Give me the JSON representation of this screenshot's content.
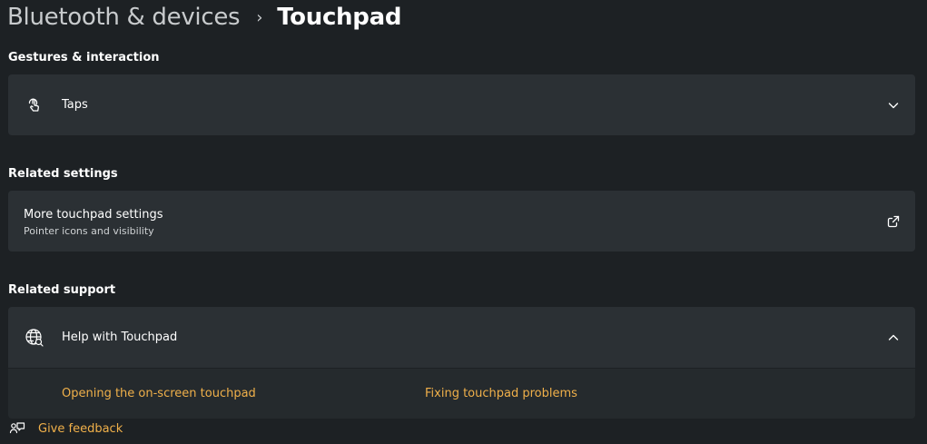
{
  "breadcrumb": {
    "parent": "Bluetooth & devices",
    "separator": "›",
    "current": "Touchpad"
  },
  "sections": {
    "gestures": {
      "title": "Gestures & interaction",
      "taps": {
        "label": "Taps",
        "icon": "touch-tap-icon",
        "chevron": "chevron-down-icon"
      }
    },
    "related_settings": {
      "title": "Related settings",
      "more": {
        "label": "More touchpad settings",
        "sublabel": "Pointer icons and visibility",
        "icon": "open-external-icon"
      }
    },
    "related_support": {
      "title": "Related support",
      "help": {
        "label": "Help with Touchpad",
        "icon": "globe-search-icon",
        "chevron": "chevron-up-icon"
      },
      "links": [
        "Opening the on-screen touchpad",
        "Fixing touchpad problems"
      ]
    }
  },
  "feedback": {
    "label": "Give feedback",
    "icon": "feedback-icon"
  },
  "colors": {
    "background": "#1d2124",
    "card": "#2b3034",
    "expanded_panel": "#252a2d",
    "link_accent": "#f0b04a"
  }
}
